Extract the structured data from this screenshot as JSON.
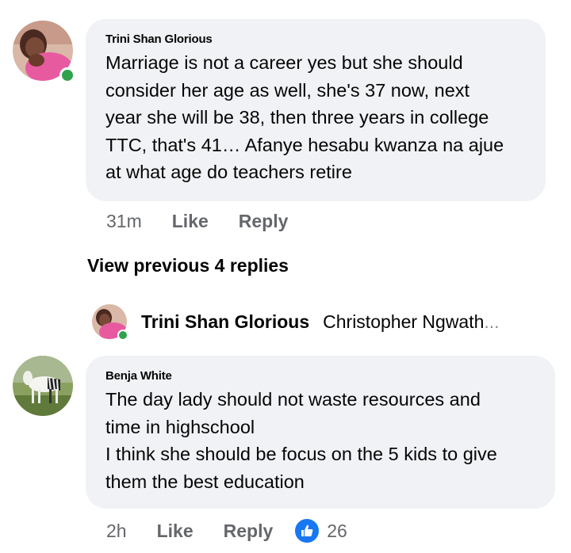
{
  "comment1": {
    "author": "Trini Shan Glorious",
    "text": "Marriage is not a career yes but she should\nconsider her age as well, she's 37 now, next\nyear she will be 38, then three years in college\nTTC, that's 41… Afanye hesabu kwanza na ajue\nat what age do teachers retire",
    "time": "31m",
    "like_label": "Like",
    "reply_label": "Reply",
    "online": true
  },
  "view_previous": "View previous 4 replies",
  "reply_preview": {
    "author": "Trini Shan Glorious",
    "snippet": "Christopher Ngwath",
    "ellipsis": "..."
  },
  "comment2": {
    "author": "Benja White",
    "text": "The day lady should not waste resources and\ntime in highschool\nI think she should be focus on the 5 kids to give\nthem the best education",
    "time": "2h",
    "like_label": "Like",
    "reply_label": "Reply",
    "reaction_count": "26",
    "reaction_icon": "thumbs-up-icon"
  },
  "colors": {
    "bubble": "#f0f2f5",
    "muted": "#65676b",
    "online": "#31a24c",
    "like_blue": "#1877f2"
  }
}
